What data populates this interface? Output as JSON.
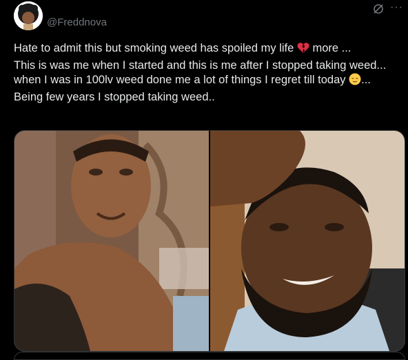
{
  "tweet": {
    "handle": "@Freddnova",
    "lines": [
      {
        "text": "Hate to admit this but smoking weed has spoiled my life",
        "emoji": "broken-heart",
        "after": " more ..."
      },
      {
        "text": "This is was me when I started and this is me after I stopped taking weed...",
        "emoji": null,
        "after": ""
      },
      {
        "text": "when I was in 100lv weed done me a lot of things I regret till today",
        "emoji": "relieved-face",
        "after": "..."
      },
      {
        "text": "Being few years I stopped taking weed..",
        "emoji": null,
        "after": ""
      }
    ]
  },
  "media": {
    "photos": [
      {
        "subject": "before-photo"
      },
      {
        "subject": "after-photo"
      }
    ]
  },
  "colors": {
    "background": "#000000",
    "text": "#e7e9ea",
    "secondary": "#71767b",
    "border": "#2f3336"
  }
}
